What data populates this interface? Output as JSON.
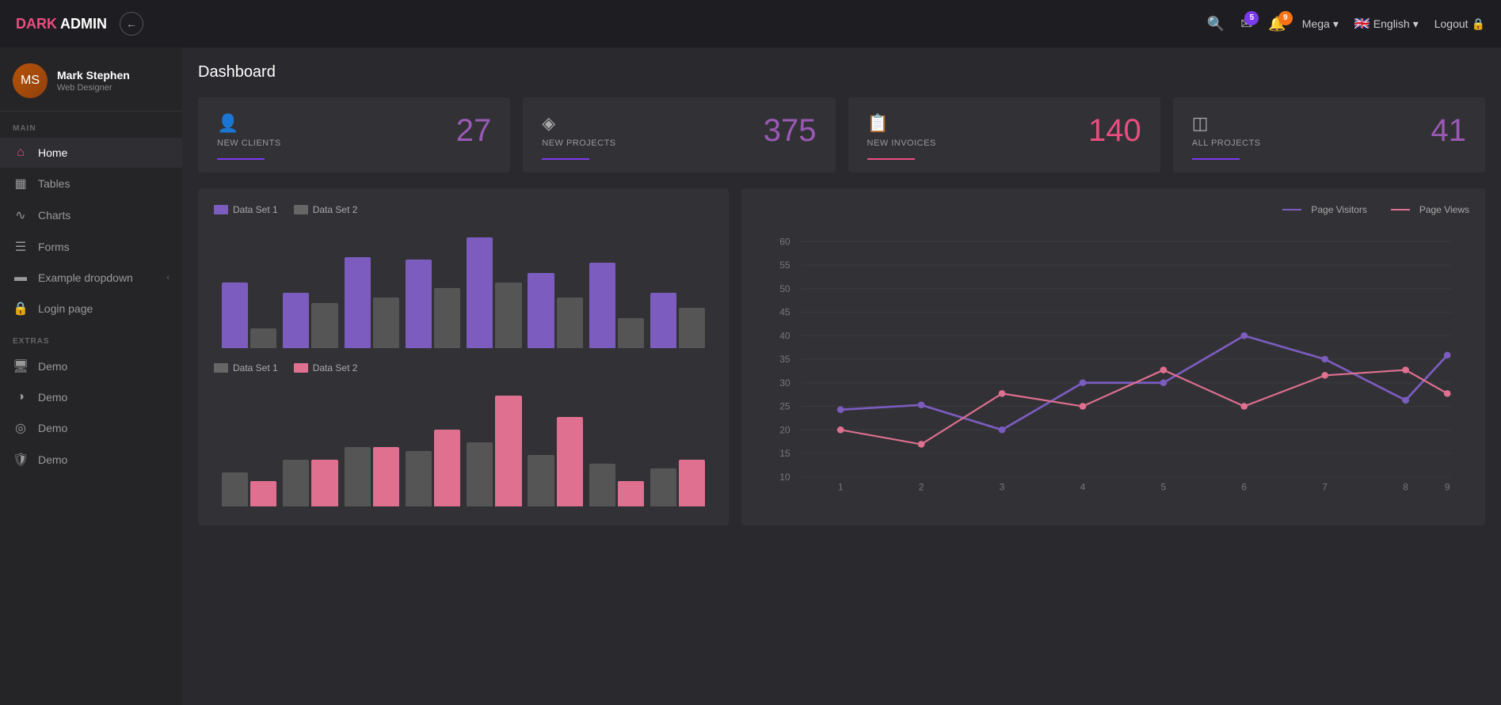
{
  "brand": {
    "dark": "DARK",
    "light": "ADMIN"
  },
  "navbar": {
    "back_icon": "←",
    "notifications_badge": "5",
    "messages_badge": "9",
    "user": "Mega",
    "flag": "🇬🇧",
    "language": "English",
    "logout": "Logout"
  },
  "sidebar": {
    "user_name": "Mark Stephen",
    "user_role": "Web Designer",
    "section_main": "MAIN",
    "section_extras": "EXTRAS",
    "items_main": [
      {
        "id": "home",
        "label": "Home",
        "icon": "⌂",
        "active": true
      },
      {
        "id": "tables",
        "label": "Tables",
        "icon": "▦",
        "active": false
      },
      {
        "id": "charts",
        "label": "Charts",
        "icon": "∿",
        "active": false
      },
      {
        "id": "forms",
        "label": "Forms",
        "icon": "☰",
        "active": false
      },
      {
        "id": "dropdown",
        "label": "Example dropdown",
        "icon": "▬",
        "active": false,
        "arrow": "‹"
      },
      {
        "id": "login",
        "label": "Login page",
        "icon": "🔒",
        "active": false
      }
    ],
    "items_extras": [
      {
        "id": "demo1",
        "label": "Demo",
        "icon": "🖥",
        "active": false
      },
      {
        "id": "demo2",
        "label": "Demo",
        "icon": "◑",
        "active": false
      },
      {
        "id": "demo3",
        "label": "Demo",
        "icon": "◎",
        "active": false
      },
      {
        "id": "demo4",
        "label": "Demo",
        "icon": "🛡",
        "active": false
      }
    ]
  },
  "page_title": "Dashboard",
  "stat_cards": [
    {
      "id": "new-clients",
      "label": "NEW CLIENTS",
      "value": "27",
      "color": "purple",
      "icon": "👤",
      "underline": "purple"
    },
    {
      "id": "new-projects",
      "label": "NEW PROJECTS",
      "value": "375",
      "color": "purple",
      "icon": "◈",
      "underline": "purple"
    },
    {
      "id": "new-invoices",
      "label": "NEW INVOICES",
      "value": "140",
      "color": "pink",
      "icon": "📋",
      "underline": "pink"
    },
    {
      "id": "all-projects",
      "label": "ALL PROJECTS",
      "value": "41",
      "color": "purple",
      "icon": "◫",
      "underline": "purple"
    }
  ],
  "bar_chart": {
    "legend": [
      {
        "label": "Data Set 1",
        "color": "purple"
      },
      {
        "label": "Data Set 2",
        "color": "gray"
      }
    ],
    "groups": [
      {
        "v1": 65,
        "v2": 20
      },
      {
        "v1": 55,
        "v2": 45
      },
      {
        "v1": 90,
        "v2": 50
      },
      {
        "v1": 88,
        "v2": 60
      },
      {
        "v1": 110,
        "v2": 65
      },
      {
        "v1": 75,
        "v2": 50
      },
      {
        "v1": 85,
        "v2": 30
      },
      {
        "v1": 55,
        "v2": 40
      }
    ]
  },
  "bar_chart2": {
    "legend": [
      {
        "label": "Data Set 1",
        "color": "gray"
      },
      {
        "label": "Data Set 2",
        "color": "pink"
      }
    ],
    "groups": [
      {
        "v1": 40,
        "v2": 30
      },
      {
        "v1": 55,
        "v2": 55
      },
      {
        "v1": 70,
        "v2": 70
      },
      {
        "v1": 65,
        "v2": 90
      },
      {
        "v1": 75,
        "v2": 130
      },
      {
        "v1": 60,
        "v2": 105
      },
      {
        "v1": 50,
        "v2": 30
      },
      {
        "v1": 45,
        "v2": 55
      }
    ]
  },
  "line_chart": {
    "legend": [
      {
        "label": "Page Visitors",
        "color": "#7c5cbf"
      },
      {
        "label": "Page Views",
        "color": "#e07090"
      }
    ],
    "y_labels": [
      10,
      15,
      20,
      25,
      30,
      35,
      40,
      45,
      50,
      55,
      60
    ],
    "x_labels": [
      1,
      2,
      3,
      4,
      5,
      6,
      7,
      8,
      9
    ],
    "series1": [
      25,
      26,
      20,
      30,
      30,
      40,
      35,
      23,
      38
    ],
    "series2": [
      20,
      17,
      27,
      25,
      33,
      25,
      32,
      33,
      27
    ]
  }
}
